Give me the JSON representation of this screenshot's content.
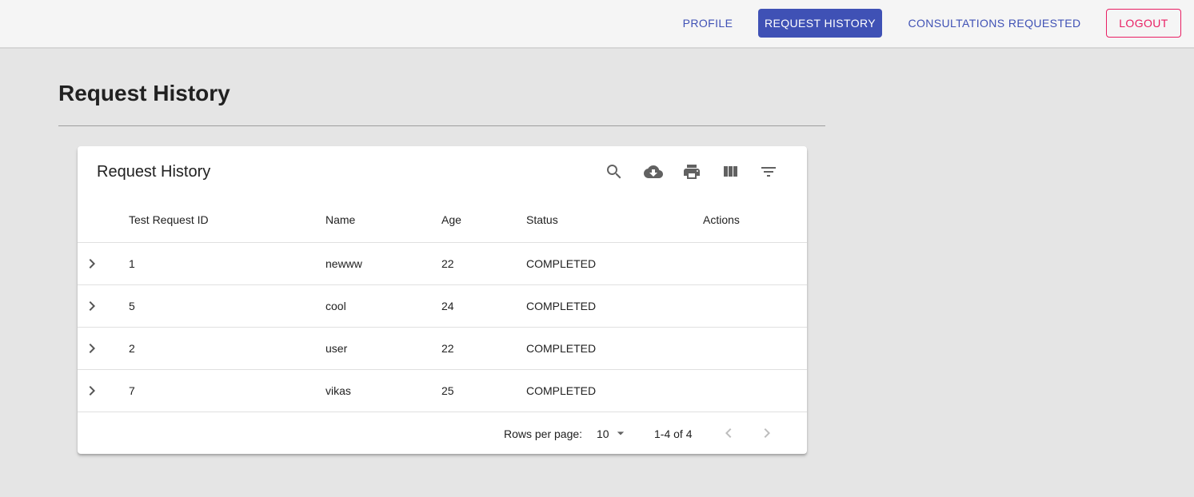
{
  "nav": {
    "profile": "PROFILE",
    "request_history": "REQUEST HISTORY",
    "consultations": "CONSULTATIONS REQUESTED",
    "logout": "LOGOUT"
  },
  "page": {
    "title": "Request History"
  },
  "table": {
    "title": "Request History",
    "toolbar_icons": [
      "search-icon",
      "cloud-download-icon",
      "print-icon",
      "view-column-icon",
      "filter-list-icon"
    ],
    "columns": {
      "id": "Test Request ID",
      "name": "Name",
      "age": "Age",
      "status": "Status",
      "actions": "Actions"
    },
    "rows": [
      {
        "id": "1",
        "name": "newww",
        "age": "22",
        "status": "COMPLETED"
      },
      {
        "id": "5",
        "name": "cool",
        "age": "24",
        "status": "COMPLETED"
      },
      {
        "id": "2",
        "name": "user",
        "age": "22",
        "status": "COMPLETED"
      },
      {
        "id": "7",
        "name": "vikas",
        "age": "25",
        "status": "COMPLETED"
      }
    ],
    "pagination": {
      "rows_per_page_label": "Rows per page:",
      "rows_per_page": "10",
      "range": "1-4 of 4"
    }
  },
  "colors": {
    "primary": "#3f51b5",
    "secondary": "#e91e63",
    "background": "#e5e5e5"
  }
}
